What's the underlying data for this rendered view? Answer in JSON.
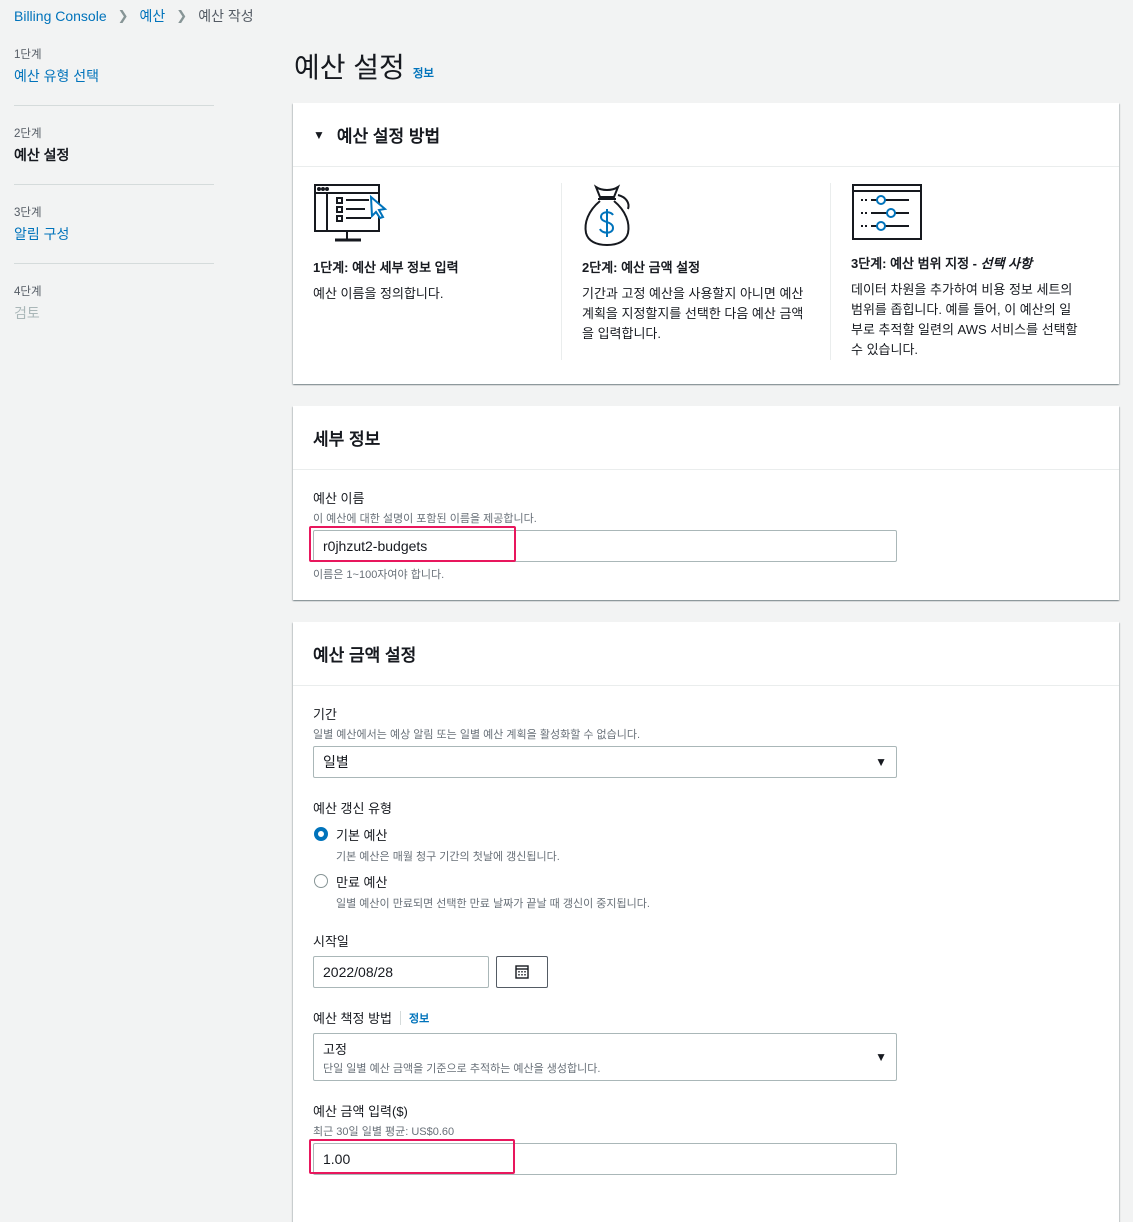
{
  "breadcrumb": {
    "items": [
      "Billing Console",
      "예산"
    ],
    "current": "예산 작성"
  },
  "steps": [
    {
      "num": "1단계",
      "name": "예산 유형 선택"
    },
    {
      "num": "2단계",
      "name": "예산 설정"
    },
    {
      "num": "3단계",
      "name": "알림 구성"
    },
    {
      "num": "4단계",
      "name": "검토"
    }
  ],
  "page": {
    "title": "예산 설정",
    "info": "정보"
  },
  "howto": {
    "title": "예산 설정 방법",
    "cols": [
      {
        "icon": "monitor-form-icon",
        "title": "1단계: 예산 세부 정보 입력",
        "desc": "예산 이름을 정의합니다."
      },
      {
        "icon": "money-bag-icon",
        "title": "2단계: 예산 금액 설정",
        "desc": "기간과 고정 예산을 사용할지 아니면 예산 계획을 지정할지를 선택한 다음 예산 금액을 입력합니다."
      },
      {
        "icon": "filter-sliders-icon",
        "title": "3단계: 예산 범위 지정 - ",
        "title_italic": "선택 사항",
        "desc": "데이터 차원을 추가하여 비용 정보 세트의 범위를 좁힙니다. 예를 들어, 이 예산의 일부로 추적할 일련의 AWS 서비스를 선택할 수 있습니다."
      }
    ]
  },
  "details": {
    "title": "세부 정보",
    "name_label": "예산 이름",
    "name_desc": "이 예산에 대한 설명이 포함된 이름을 제공합니다.",
    "name_value": "r0jhzut2-budgets",
    "name_constraint": "이름은 1~100자여야 합니다."
  },
  "amount": {
    "title": "예산 금액 설정",
    "period_label": "기간",
    "period_desc": "일별 예산에서는 예상 알림 또는 일별 예산 계획을 활성화할 수 없습니다.",
    "period_value": "일별",
    "renewal_label": "예산 갱신 유형",
    "renewal_options": [
      {
        "label": "기본 예산",
        "desc": "기본 예산은 매월 청구 기간의 첫날에 갱신됩니다.",
        "selected": true
      },
      {
        "label": "만료 예산",
        "desc": "일별 예산이 만료되면 선택한 만료 날짜가 끝날 때 갱신이 중지됩니다.",
        "selected": false
      }
    ],
    "start_label": "시작일",
    "start_value": "2022/08/28",
    "method_label": "예산 책정 방법",
    "method_info": "정보",
    "method_value": "고정",
    "method_desc": "단일 일별 예산 금액을 기준으로 추적하는 예산을 생성합니다.",
    "amount_label": "예산 금액 입력($)",
    "amount_desc": "최근 30일 일별 평균: US$0.60",
    "amount_value": "1.00"
  }
}
